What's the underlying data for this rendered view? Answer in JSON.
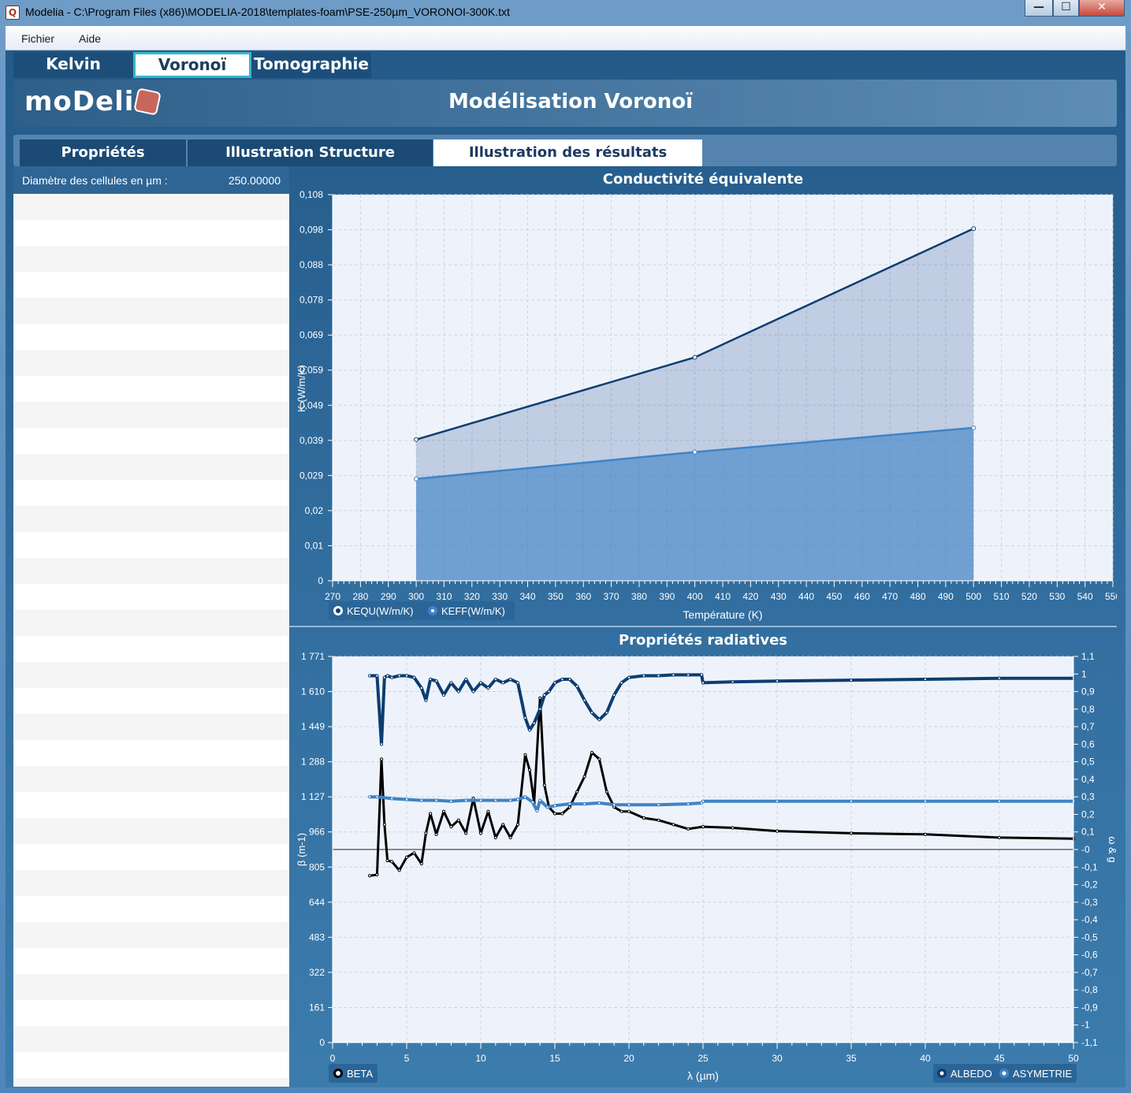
{
  "window": {
    "title": "Modelia - C:\\Program Files (x86)\\MODELIA-2018\\templates-foam\\PSE-250µm_VORONOI-300K.txt",
    "app_icon": "Q",
    "minimize_glyph": "—",
    "maximize_glyph": "☐",
    "close_glyph": "✕"
  },
  "menu": {
    "items": [
      "Fichier",
      "Aide"
    ]
  },
  "main_tabs": [
    {
      "label": "Kelvin",
      "active": false
    },
    {
      "label": "Voronoï",
      "active": true
    },
    {
      "label": "Tomographie",
      "active": false
    }
  ],
  "header": {
    "logo_text": "moDeli",
    "title": "Modélisation Voronoï"
  },
  "sub_tabs": [
    {
      "label": "Propriétés",
      "active": false
    },
    {
      "label": "Illustration Structure",
      "active": false
    },
    {
      "label": "Illustration des résultats",
      "active": true
    }
  ],
  "properties": {
    "label": "Diamètre des cellules en µm :",
    "value": "250.00000"
  },
  "colors": {
    "dark_series": "#0d3d70",
    "light_series": "#3f83c6",
    "beta": "#000000",
    "accent": "#36b5c9"
  },
  "chart_data": [
    {
      "type": "area",
      "title": "Conductivité équivalente",
      "xlabel": "Température (K)",
      "ylabel": "K (W/m/K)",
      "xlim": [
        270,
        550
      ],
      "ylim": [
        0,
        0.108
      ],
      "yticks": [
        "0",
        "0,01",
        "0,02",
        "0,029",
        "0,039",
        "0,049",
        "0,059",
        "0,069",
        "0,078",
        "0,088",
        "0,098",
        "0,108"
      ],
      "xticks": [
        "270",
        "280",
        "290",
        "300",
        "310",
        "320",
        "330",
        "340",
        "350",
        "360",
        "370",
        "380",
        "390",
        "400",
        "410",
        "420",
        "430",
        "440",
        "450",
        "460",
        "470",
        "480",
        "490",
        "500",
        "510",
        "520",
        "530",
        "540",
        "550"
      ],
      "x": [
        300,
        400,
        500
      ],
      "series": [
        {
          "name": "KEQU(W/m/K)",
          "values": [
            0.0395,
            0.0625,
            0.0985
          ]
        },
        {
          "name": "KEFF(W/m/K)",
          "values": [
            0.0285,
            0.036,
            0.0428
          ]
        }
      ],
      "grid": true,
      "legend": "bottom-left"
    },
    {
      "type": "line",
      "title": "Propriétés radiatives",
      "xlabel": "λ (µm)",
      "ylabel_left": "β (m-1)",
      "ylabel_right": "ω & g",
      "xlim": [
        0,
        50
      ],
      "ylim_left": [
        0,
        1771
      ],
      "ylim_right": [
        -1.1,
        1.1
      ],
      "xticks": [
        "0",
        "5",
        "10",
        "15",
        "20",
        "25",
        "30",
        "35",
        "40",
        "45",
        "50"
      ],
      "yticks_left": [
        "0",
        "161",
        "322",
        "483",
        "644",
        "805",
        "966",
        "1 127",
        "1 288",
        "1 449",
        "1 610",
        "1 771"
      ],
      "yticks_right": [
        "-1,1",
        "-1",
        "-0,9",
        "-0,8",
        "-0,7",
        "-0,6",
        "-0,5",
        "-0,4",
        "-0,3",
        "-0,2",
        "-0,1",
        "-0",
        "0,1",
        "0,2",
        "0,3",
        "0,4",
        "0,5",
        "0,6",
        "0,7",
        "0,8",
        "0,9",
        "1",
        "1,1"
      ],
      "series": [
        {
          "name": "BETA",
          "axis": "left",
          "x": [
            2.5,
            3.0,
            3.3,
            3.5,
            3.7,
            4.0,
            4.5,
            5.0,
            5.5,
            6.0,
            6.3,
            6.6,
            7.0,
            7.5,
            8.0,
            8.5,
            9.0,
            9.5,
            10.0,
            10.5,
            11.0,
            11.5,
            12.0,
            12.5,
            13.0,
            13.3,
            13.6,
            14.0,
            14.3,
            14.6,
            15.0,
            15.5,
            16.0,
            16.5,
            17.0,
            17.5,
            18.0,
            18.5,
            19.0,
            19.5,
            20.0,
            21.0,
            22.0,
            23.0,
            24.0,
            25.0,
            27.0,
            30.0,
            35.0,
            40.0,
            45.0,
            50.0
          ],
          "values": [
            765,
            770,
            1300,
            1000,
            835,
            830,
            790,
            850,
            870,
            820,
            960,
            1050,
            955,
            1060,
            990,
            1020,
            960,
            1120,
            960,
            1060,
            940,
            1000,
            940,
            1000,
            1320,
            1250,
            1100,
            1580,
            1180,
            1080,
            1050,
            1050,
            1080,
            1150,
            1220,
            1330,
            1300,
            1150,
            1080,
            1060,
            1060,
            1030,
            1020,
            1000,
            980,
            990,
            985,
            970,
            960,
            955,
            940,
            935
          ]
        },
        {
          "name": "ALBEDO",
          "axis": "right",
          "x": [
            2.5,
            3.0,
            3.3,
            3.5,
            3.7,
            4.0,
            4.5,
            5.0,
            5.5,
            6.0,
            6.3,
            6.6,
            7.0,
            7.5,
            8.0,
            8.5,
            9.0,
            9.5,
            10.0,
            10.5,
            11.0,
            11.5,
            12.0,
            12.5,
            13.0,
            13.3,
            13.6,
            14.0,
            14.3,
            14.6,
            15.0,
            15.5,
            16.0,
            16.5,
            17.0,
            17.5,
            18.0,
            18.5,
            19.0,
            19.5,
            20.0,
            21.0,
            22.0,
            23.0,
            24.0,
            24.9,
            25.0,
            27.0,
            30.0,
            35.0,
            40.0,
            45.0,
            50.0
          ],
          "values": [
            0.99,
            0.99,
            0.6,
            0.98,
            0.99,
            0.98,
            0.99,
            0.99,
            0.98,
            0.92,
            0.85,
            0.97,
            0.96,
            0.88,
            0.95,
            0.9,
            0.97,
            0.9,
            0.95,
            0.92,
            0.97,
            0.95,
            0.97,
            0.95,
            0.75,
            0.68,
            0.72,
            0.8,
            0.88,
            0.9,
            0.95,
            0.97,
            0.97,
            0.93,
            0.85,
            0.78,
            0.74,
            0.78,
            0.88,
            0.95,
            0.98,
            0.99,
            0.99,
            0.995,
            0.995,
            0.995,
            0.95,
            0.955,
            0.96,
            0.965,
            0.97,
            0.975,
            0.975
          ]
        },
        {
          "name": "ASYMETRIE",
          "axis": "right",
          "x": [
            2.5,
            3.0,
            4.0,
            5.0,
            6.0,
            7.0,
            8.0,
            9.0,
            10.0,
            11.0,
            12.0,
            12.5,
            13.0,
            13.5,
            13.8,
            14.0,
            14.5,
            15.0,
            16.0,
            17.0,
            18.0,
            19.0,
            20.0,
            22.0,
            24.0,
            24.9,
            25.0,
            30.0,
            35.0,
            40.0,
            45.0,
            50.0
          ],
          "values": [
            0.3,
            0.3,
            0.29,
            0.285,
            0.28,
            0.28,
            0.275,
            0.28,
            0.28,
            0.28,
            0.28,
            0.285,
            0.3,
            0.27,
            0.22,
            0.28,
            0.24,
            0.25,
            0.26,
            0.26,
            0.265,
            0.255,
            0.255,
            0.255,
            0.26,
            0.265,
            0.275,
            0.275,
            0.275,
            0.275,
            0.275,
            0.275
          ]
        }
      ],
      "legend_left": "bottom-left",
      "legend_right": "bottom-right"
    }
  ]
}
